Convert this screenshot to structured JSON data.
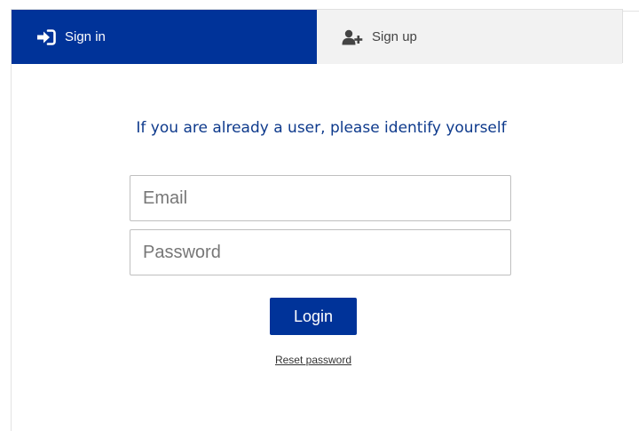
{
  "tabs": {
    "signin": {
      "label": "Sign in",
      "icon": "sign-in-icon"
    },
    "signup": {
      "label": "Sign up",
      "icon": "add-user-icon"
    }
  },
  "form": {
    "heading": "If you are already a user, please identify yourself",
    "email": {
      "placeholder": "Email",
      "value": ""
    },
    "password": {
      "placeholder": "Password",
      "value": ""
    },
    "login_label": "Login",
    "reset_label": "Reset password"
  },
  "colors": {
    "primary": "#003399",
    "heading": "#0e3a8c",
    "inactive_tab": "#f2f2f2"
  }
}
